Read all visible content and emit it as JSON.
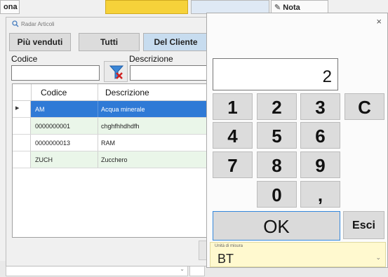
{
  "background": {
    "top_left_label": "ona",
    "nota_label": "Nota"
  },
  "radar": {
    "title": "Radar Articoli",
    "tabs": [
      "Più venduti",
      "Tutti",
      "Del Cliente"
    ],
    "codice_label": "Codice",
    "descrizione_label": "Descrizione",
    "codice_value": "",
    "descrizione_value": "",
    "grid": {
      "headers": [
        "Codice",
        "Descrizione"
      ],
      "rows": [
        {
          "codice": "AM",
          "descrizione": "Acqua minerale",
          "selected": true
        },
        {
          "codice": "0000000001",
          "descrizione": "chghfhhdhdfh",
          "selected": false
        },
        {
          "codice": "0000000013",
          "descrizione": "RAM",
          "selected": false
        },
        {
          "codice": "ZUCH",
          "descrizione": "Zucchero",
          "selected": false
        }
      ]
    }
  },
  "keypad": {
    "close": "×",
    "display_value": "2",
    "keys": [
      "1",
      "2",
      "3",
      "C",
      "4",
      "5",
      "6",
      "7",
      "8",
      "9",
      "0",
      ","
    ],
    "ok_label": "OK",
    "esci_label": "Esci",
    "unit_label": "Unità di misura",
    "unit_value": "BT"
  },
  "colors": {
    "selected_row": "#2f7ad6",
    "alt_row": "#eaf6e9",
    "active_tab": "#c7dcef",
    "unit_bg": "#fff9cf"
  }
}
